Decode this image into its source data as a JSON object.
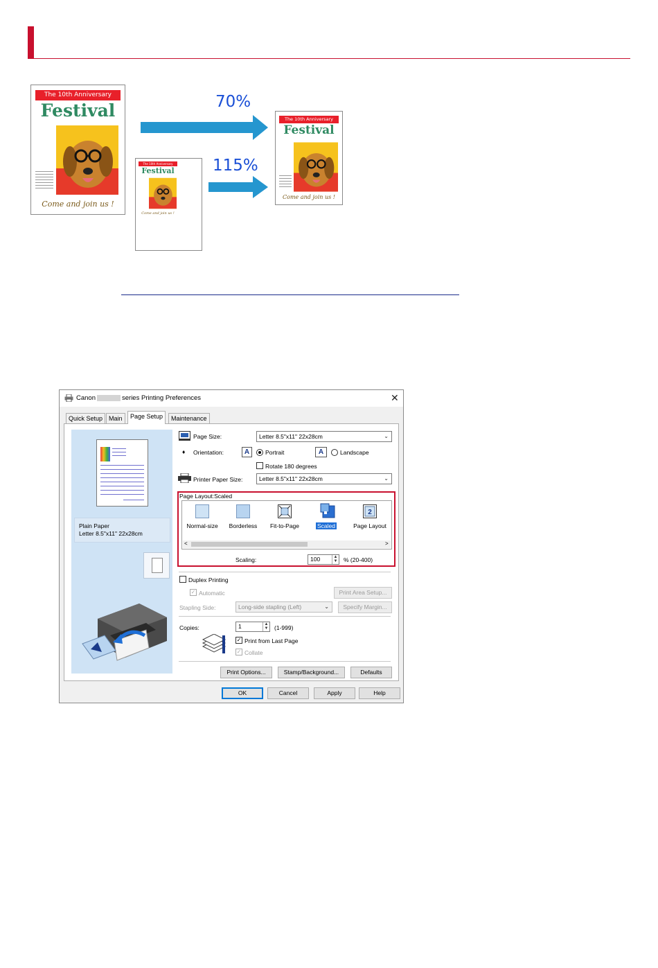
{
  "illustration": {
    "poster": {
      "banner": "The 10th Anniversary",
      "title": "Festival",
      "tagline": "Come and join us !"
    },
    "arrows": [
      {
        "label": "70%"
      },
      {
        "label": "115%"
      }
    ]
  },
  "dialog": {
    "title_prefix": "Canon",
    "title_suffix": "series Printing Preferences",
    "close_glyph": "✕",
    "tabs": [
      "Quick Setup",
      "Main",
      "Page Setup",
      "Maintenance"
    ],
    "active_tab": "Page Setup",
    "preview": {
      "media_type": "Plain Paper",
      "media_size": "Letter 8.5\"x11\" 22x28cm"
    },
    "page_size": {
      "label": "Page Size:",
      "value": "Letter 8.5\"x11\" 22x28cm"
    },
    "orientation": {
      "label": "Orientation:",
      "portrait": "Portrait",
      "landscape": "Landscape",
      "selected": "Portrait",
      "rotate_label": "Rotate 180 degrees",
      "rotate_checked": false
    },
    "printer_paper_size": {
      "label": "Printer Paper Size:",
      "value": "Letter 8.5\"x11\" 22x28cm"
    },
    "page_layout": {
      "label": "Page Layout:",
      "current": "Scaled",
      "options": [
        "Normal-size",
        "Borderless",
        "Fit-to-Page",
        "Scaled",
        "Page Layout"
      ],
      "selected": "Scaled",
      "scroll_left": "<",
      "scroll_right": ">"
    },
    "scaling": {
      "label": "Scaling:",
      "value": "100",
      "range": "% (20-400)"
    },
    "duplex": {
      "label": "Duplex Printing",
      "checked": false,
      "automatic_label": "Automatic",
      "print_area_setup": "Print Area Setup...",
      "stapling_label": "Stapling Side:",
      "stapling_value": "Long-side stapling (Left)",
      "specify_margin": "Specify Margin..."
    },
    "copies": {
      "label": "Copies:",
      "value": "1",
      "range": "(1-999)",
      "print_from_last_label": "Print from Last Page",
      "print_from_last_checked": true,
      "collate_label": "Collate",
      "collate_checked": true
    },
    "lower_buttons": [
      "Print Options...",
      "Stamp/Background...",
      "Defaults"
    ],
    "footer_buttons": [
      "OK",
      "Cancel",
      "Apply",
      "Help"
    ]
  },
  "colors": {
    "accent_red": "#c8102e",
    "percent_blue": "#1a4fd6",
    "arrow_blue": "#2596cf",
    "selection_blue": "#1f6fd6"
  }
}
